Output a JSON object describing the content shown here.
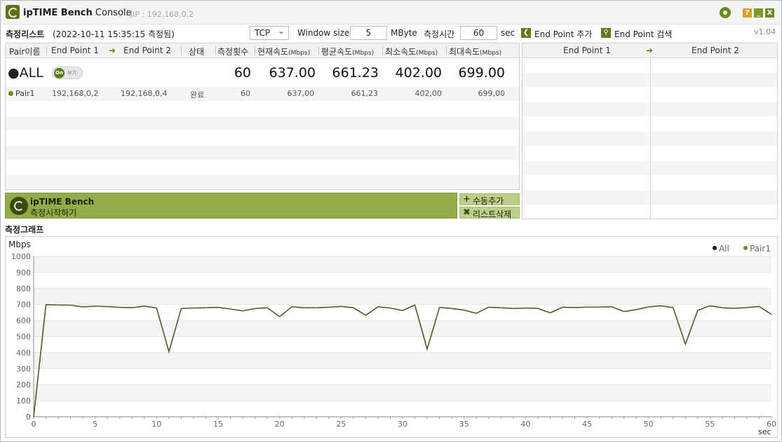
{
  "titlebar": {
    "app_name_bold": "ipTIME Bench",
    "app_name_light": " Console",
    "ip_separator": "|",
    "ip_label": "내IP : 192,168,0,2",
    "help_label": "?",
    "minimize_label": "_",
    "close_label": "X"
  },
  "toolbar": {
    "list_title": "측정리스트",
    "list_subtitle": "(2022-10-11 15:35:15 측정됨)",
    "protocol": "TCP",
    "window_size_label": "Window size",
    "window_size_value": "5",
    "window_size_unit": "MByte",
    "duration_label": "측정시간",
    "duration_value": "60",
    "duration_unit": "sec",
    "add_endpoint_label": "End Point 추가",
    "search_endpoint_label": "End Point 검색",
    "version": "v1.04"
  },
  "list": {
    "columns": [
      "Pair이름",
      "End Point 1",
      "End Point 2",
      "상태",
      "측정횟수",
      "현재속도",
      "평균속도",
      "최소속도",
      "최대속도"
    ],
    "unit": "(Mbps)",
    "all_row": {
      "name": "ALL",
      "toggle_on": "On",
      "toggle_label": "보기",
      "count": "60",
      "current": "637.00",
      "average": "661.23",
      "min": "402.00",
      "max": "699.00"
    },
    "pairs": [
      {
        "name": "Pair1",
        "endpoint1": "192,168,0,2",
        "endpoint2": "192,168,0,4",
        "status": "완료",
        "count": "60",
        "current": "637,00",
        "average": "661,23",
        "min": "402,00",
        "max": "699,00"
      }
    ]
  },
  "start": {
    "title": "ipTIME Bench",
    "subtitle": "측정시작하기",
    "add_manual_label": "수동추가",
    "delete_list_label": "리스트삭제"
  },
  "endpoints": {
    "col1": "End Point 1",
    "col2": "End Point 2"
  },
  "graph": {
    "section_title": "측정그래프",
    "legend_all": "All",
    "legend_pair1": "Pair1"
  },
  "colors": {
    "accent": "#6b8a1e",
    "line": "#4a5a2a",
    "start_bar": "#93ac4a"
  },
  "chart_data": {
    "type": "line",
    "ylabel": "Mbps",
    "xlabel": "sec",
    "xlim": [
      0,
      60
    ],
    "ylim": [
      0,
      1000
    ],
    "x_ticks": [
      0,
      5,
      10,
      15,
      20,
      25,
      30,
      35,
      40,
      45,
      50,
      55,
      60
    ],
    "y_ticks": [
      0,
      100,
      200,
      300,
      400,
      500,
      600,
      700,
      800,
      900,
      1000
    ],
    "x": [
      0,
      1,
      2,
      3,
      4,
      5,
      6,
      7,
      8,
      9,
      10,
      11,
      12,
      13,
      14,
      15,
      16,
      17,
      18,
      19,
      20,
      21,
      22,
      23,
      24,
      25,
      26,
      27,
      28,
      29,
      30,
      31,
      32,
      33,
      34,
      35,
      36,
      37,
      38,
      39,
      40,
      41,
      42,
      43,
      44,
      45,
      46,
      47,
      48,
      49,
      50,
      51,
      52,
      53,
      54,
      55,
      56,
      57,
      58,
      59,
      60
    ],
    "series": [
      {
        "name": "Pair1",
        "values": [
          0,
          699,
          697,
          696,
          685,
          690,
          687,
          682,
          680,
          690,
          678,
          406,
          675,
          678,
          680,
          682,
          672,
          660,
          675,
          680,
          624,
          686,
          680,
          680,
          683,
          688,
          680,
          633,
          686,
          678,
          662,
          697,
          422,
          682,
          675,
          665,
          645,
          683,
          680,
          675,
          678,
          676,
          648,
          683,
          681,
          684,
          684,
          686,
          656,
          668,
          685,
          692,
          681,
          452,
          664,
          692,
          680,
          676,
          681,
          688,
          638
        ]
      }
    ],
    "legend": [
      "All",
      "Pair1"
    ],
    "legend_position": "top-right",
    "grid": true
  }
}
